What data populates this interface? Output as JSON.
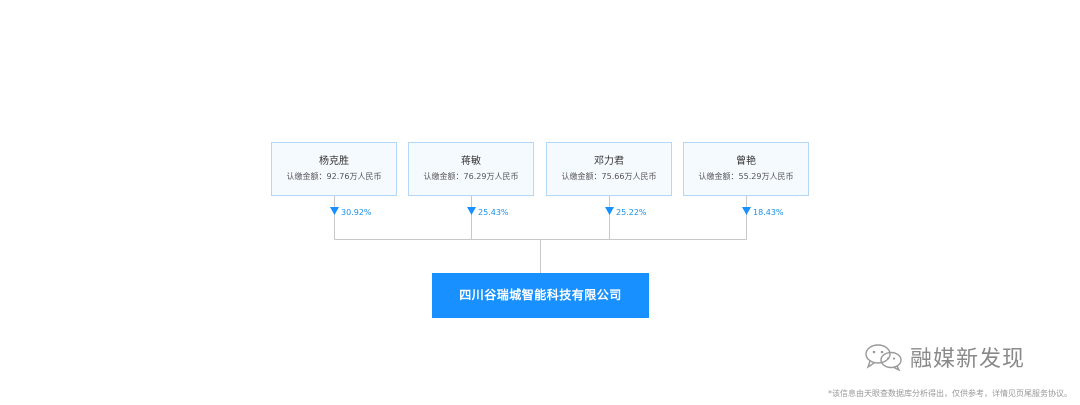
{
  "shareholders": [
    {
      "name": "杨克胜",
      "amount": "认缴金额：92.76万人民币",
      "percent": "30.92%"
    },
    {
      "name": "蒋敏",
      "amount": "认缴金额：76.29万人民币",
      "percent": "25.43%"
    },
    {
      "name": "邓力君",
      "amount": "认缴金额：75.66万人民币",
      "percent": "25.22%"
    },
    {
      "name": "曾艳",
      "amount": "认缴金额：55.29万人民币",
      "percent": "18.43%"
    }
  ],
  "company": {
    "name": "四川谷瑞城智能科技有限公司"
  },
  "watermark": {
    "text": "融媒新发现",
    "icon": "wechat-icon"
  },
  "disclaimer": "*该信息由天眼查数据库分析得出，仅供参考，详情见页尾服务协议。",
  "colors": {
    "accent": "#1890ff",
    "box_border": "#b4d7f5",
    "box_bg": "#f5faff",
    "percent_text": "#1890e8",
    "line": "#c8c8c8"
  }
}
